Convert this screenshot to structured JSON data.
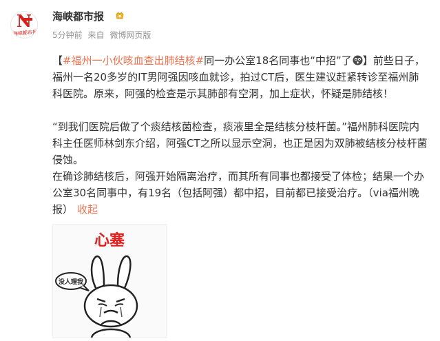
{
  "account": {
    "name": "海峡都市报",
    "avatar_letter": "N",
    "avatar_script": "海峡都市报",
    "badge_icon": "gold-verified-badge-icon"
  },
  "meta": {
    "time": "5分钟前",
    "from_label": "来自",
    "source": "微博网页版"
  },
  "post": {
    "open_bracket": "【",
    "hashtag_1": "#福州一小伙咳血查出肺结核#",
    "headline": "同一办公室18名同事也“中招”了",
    "emoji_icon": "surprised-face-emoji-icon",
    "close_bracket": "】",
    "paragraph_1_rest": "前些日子，福州一名20多岁的IT男阿强因咳血就诊，拍过CT后，医生建议赶紧转诊至福州肺科医院。原来，阿强的检查是示其肺部有空洞，加上症状，怀疑是肺结核！",
    "paragraph_2": "“到我们医院后做了个痰结核菌检查，痰液里全是结核分枝杆菌。”福州肺科医院内科主任医师林剑东介绍，阿强CT之所以显示空洞，也正是因为双肺被结核分枝杆菌侵蚀。",
    "paragraph_3": "在确诊肺结核后，阿强开始隔离治疗，而其所有同事也都接受了体检；结果一个办公室30名同事中，有19名（包括阿强）都中招，目前都已接受治疗。（via福州晚报）",
    "collapse_label": "收起"
  },
  "image": {
    "caption_big": "心塞",
    "bubble_text": "没人理我",
    "icon": "sad-rabbit-meme-icon",
    "colors": {
      "caption": "#e0201e",
      "outline": "#222222"
    }
  }
}
